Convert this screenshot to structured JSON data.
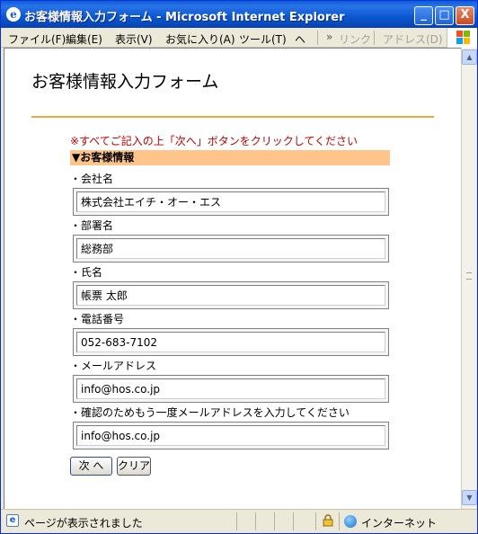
{
  "window": {
    "title": "お客様情報入力フォーム - Microsoft Internet Explorer",
    "minimize": "_",
    "maximize": "□",
    "close": "X"
  },
  "menu": {
    "items": [
      "ファイル(F)",
      "編集(E)",
      "表示(V)",
      "お気に入り(A)",
      "ツール(T)",
      "ヘ"
    ],
    "links_label": "リンク",
    "address_label": "アドレス(D)",
    "chevron": "»"
  },
  "page": {
    "title": "お客様情報入力フォーム",
    "notice": "※すべてご記入の上「次へ」ボタンをクリックしてください",
    "section_title": "▼お客様情報",
    "fields": [
      {
        "label": "・会社名",
        "value": "株式会社エイチ・オー・エス"
      },
      {
        "label": "・部署名",
        "value": "総務部"
      },
      {
        "label": "・氏名",
        "value": "帳票 太郎"
      },
      {
        "label": "・電話番号",
        "value": "052-683-7102"
      },
      {
        "label": "・メールアドレス",
        "value": "info@hos.co.jp"
      },
      {
        "label": "・確認のためもう一度メールアドレスを入力してください",
        "value": "info@hos.co.jp"
      }
    ],
    "next_button": "次 へ",
    "clear_button": "クリア"
  },
  "status": {
    "text": "ページが表示されました",
    "zone": "インターネット"
  },
  "colors": {
    "accent_rule": "#f1a73c",
    "section_bar": "#ffc48a",
    "notice_text": "#c00000",
    "titlebar": "#0a57d0"
  },
  "icons": [
    "ie-icon",
    "minimize-icon",
    "maximize-icon",
    "close-icon",
    "windows-logo-icon",
    "scroll-up-icon",
    "scroll-down-icon",
    "page-icon",
    "lock-icon",
    "internet-zone-icon"
  ]
}
